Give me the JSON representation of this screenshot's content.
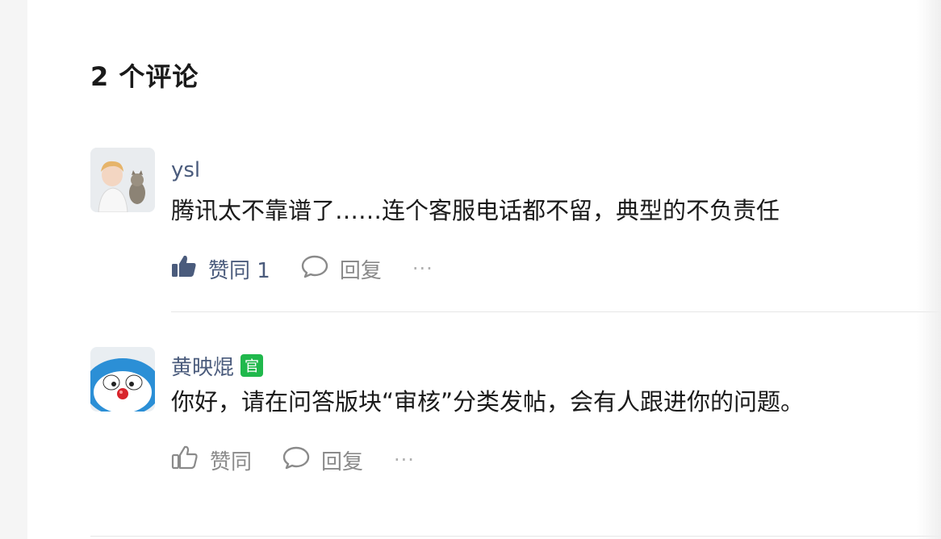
{
  "section": {
    "title": "2 个评论"
  },
  "comments": [
    {
      "author": "ysl",
      "text": "腾讯太不靠谱了……连个客服电话都不留，典型的不负责任",
      "like_label": "赞同 1",
      "reply_label": "回复",
      "more_label": "···"
    },
    {
      "author": "黄映焜",
      "badge": "官",
      "text": "你好，请在问答版块“审核”分类发帖，会有人跟进你的问题。",
      "like_label": "赞同",
      "reply_label": "回复",
      "more_label": "···"
    }
  ],
  "colors": {
    "author": "#4a5b7c",
    "badge": "#20b84c",
    "muted": "#8a8a8a"
  },
  "icons": {
    "like_active": "thumbs-up-filled-icon",
    "like": "thumbs-up-outline-icon",
    "reply": "speech-bubble-icon",
    "more": "ellipsis-icon"
  }
}
